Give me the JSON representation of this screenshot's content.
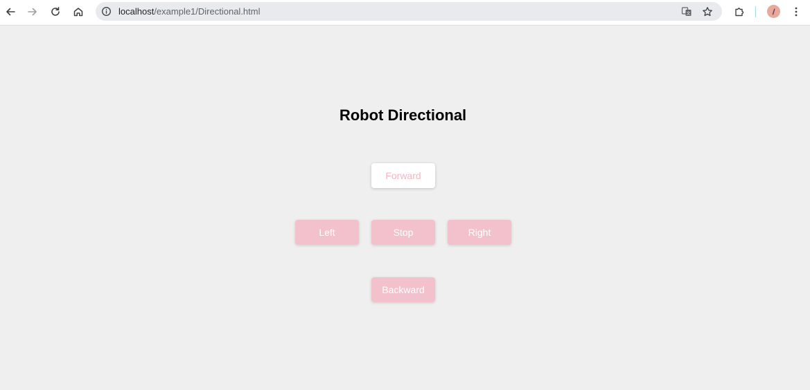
{
  "browser": {
    "url_host": "localhost",
    "url_path": "/example1/Directional.html",
    "icons": {
      "back": "arrow-left-icon",
      "forward": "arrow-right-icon",
      "reload": "reload-icon",
      "home": "home-icon",
      "site_info": "info-icon",
      "translate": "translate-icon",
      "bookmark": "star-icon",
      "extensions": "puzzle-icon",
      "profile": "avatar",
      "menu": "kebab-menu-icon"
    }
  },
  "page": {
    "title": "Robot Directional",
    "buttons": {
      "forward": "Forward",
      "left": "Left",
      "stop": "Stop",
      "right": "Right",
      "backward": "Backward"
    },
    "active_button": "forward",
    "colors": {
      "button_bg": "#f3c1cb",
      "button_text": "#ffffff",
      "active_bg": "#ffffff",
      "active_text": "#f4b6c3",
      "page_bg": "#efefef"
    }
  }
}
